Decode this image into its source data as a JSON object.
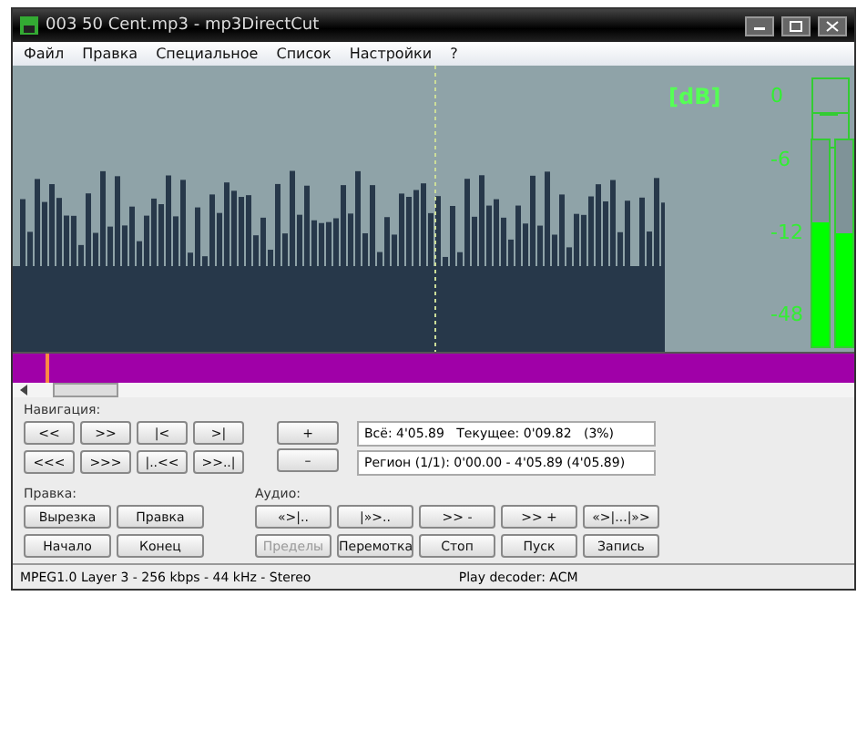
{
  "window": {
    "title": "003 50 Cent.mp3 - mp3DirectCut"
  },
  "menu": [
    "Файл",
    "Правка",
    "Специальное",
    "Список",
    "Настройки",
    "?"
  ],
  "meter": {
    "unit": "[dB]",
    "ticks": [
      "0",
      "-6",
      "-12",
      "-48"
    ],
    "channels": [
      {
        "level": 0.6
      },
      {
        "level": 0.55
      }
    ]
  },
  "navigation": {
    "label": "Навигация:",
    "buttons": [
      "<<",
      ">>",
      "|<",
      ">|",
      "<<<",
      ">>>",
      "|..<<",
      ">>..|"
    ],
    "zoom_buttons": [
      "+",
      "–"
    ]
  },
  "info": [
    "Всё: 4'05.89   Текущее: 0'09.82   (3%)",
    "Регион (1/1): 0'00.00 - 4'05.89 (4'05.89)"
  ],
  "edit": {
    "label": "Правка:",
    "buttons": [
      "Вырезка",
      "Правка",
      "Начало",
      "Конец"
    ]
  },
  "audio": {
    "label": "Аудио:",
    "buttons": [
      {
        "text": "«>|..",
        "disabled": false
      },
      {
        "text": "|»>..",
        "disabled": false
      },
      {
        "text": ">> -",
        "disabled": false
      },
      {
        "text": ">> +",
        "disabled": false
      },
      {
        "text": "«>|...|»>",
        "disabled": false
      },
      {
        "text": "Пределы",
        "disabled": true
      },
      {
        "text": "Перемотка",
        "disabled": false
      },
      {
        "text": "Стоп",
        "disabled": false
      },
      {
        "text": "Пуск",
        "disabled": false
      },
      {
        "text": "Запись",
        "disabled": false
      }
    ]
  },
  "status_bar": [
    "MPEG1.0 Layer 3 - 256 kbps - 44 kHz - Stereo",
    "Play decoder: ACM"
  ]
}
